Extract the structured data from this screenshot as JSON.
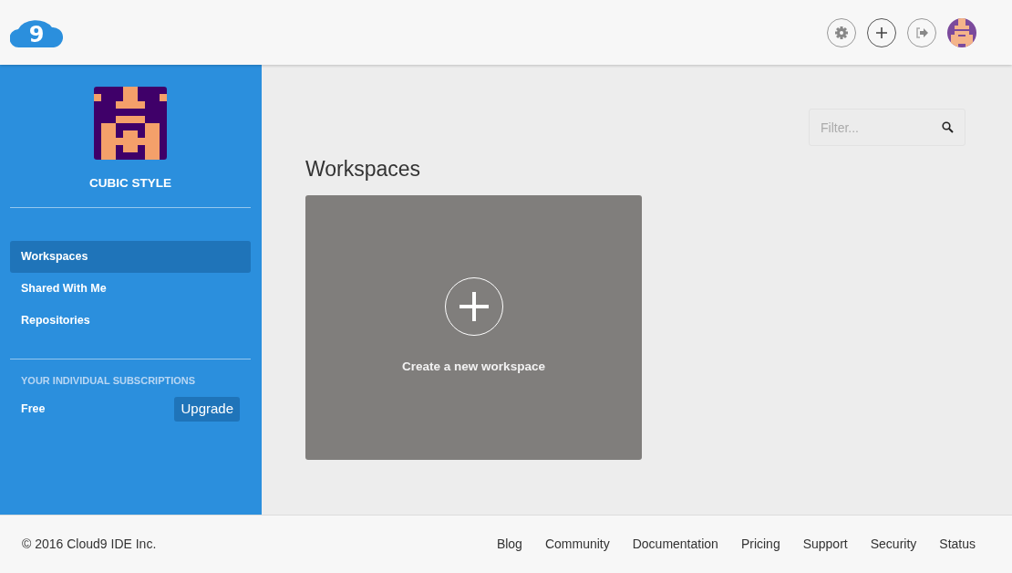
{
  "header": {
    "logo_text": "9"
  },
  "profile": {
    "name": "CUBIC STYLE"
  },
  "sidebar": {
    "items": [
      {
        "label": "Workspaces",
        "selected": true
      },
      {
        "label": "Shared With Me",
        "selected": false
      },
      {
        "label": "Repositories",
        "selected": false
      }
    ],
    "subscriptions_heading": "YOUR INDIVIDUAL SUBSCRIPTIONS",
    "plan": "Free",
    "upgrade_button": "Upgrade"
  },
  "filter": {
    "placeholder": "Filter..."
  },
  "main": {
    "title": "Workspaces",
    "create_card": {
      "label": "Create a new workspace"
    }
  },
  "footer": {
    "copyright": "© 2016 Cloud9 IDE Inc.",
    "links": [
      "Blog",
      "Community",
      "Documentation",
      "Pricing",
      "Support",
      "Security",
      "Status"
    ]
  }
}
